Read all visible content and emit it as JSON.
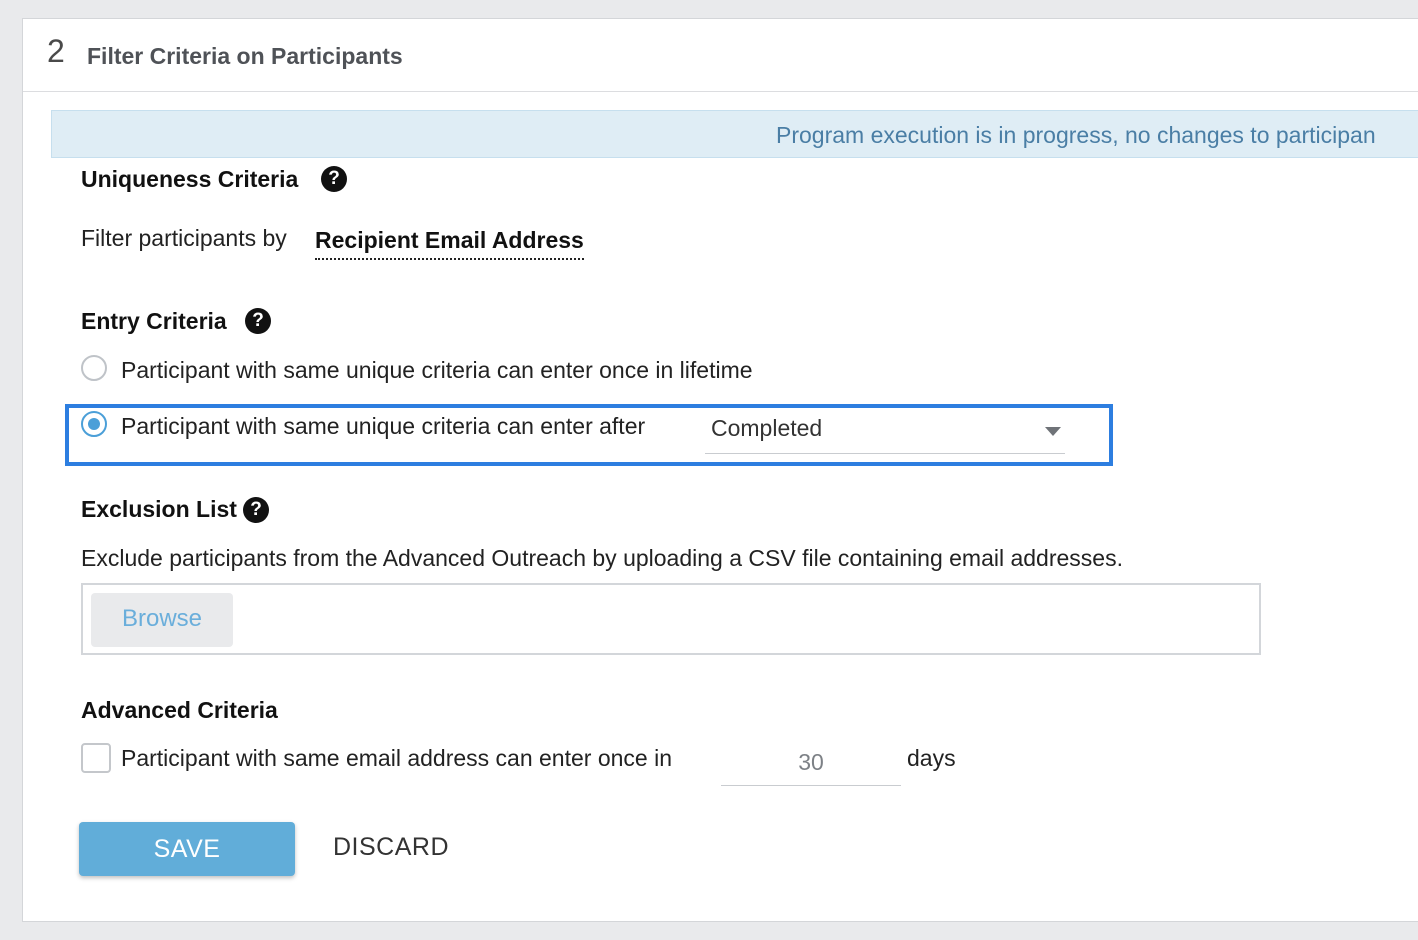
{
  "header": {
    "step_number": "2",
    "title": "Filter Criteria on Participants"
  },
  "banner": {
    "message": "Program execution is in progress, no changes to participan"
  },
  "uniqueness": {
    "title": "Uniqueness Criteria",
    "filter_label": "Filter participants by",
    "filter_value": "Recipient Email Address"
  },
  "entry": {
    "title": "Entry Criteria",
    "option_once": "Participant with same unique criteria can enter once in lifetime",
    "option_after": "Participant with same unique criteria can enter after",
    "selected_option": "option_after",
    "after_select_value": "Completed"
  },
  "exclusion": {
    "title": "Exclusion List",
    "description": "Exclude participants from the Advanced Outreach by uploading a CSV file containing email addresses.",
    "browse_label": "Browse"
  },
  "advanced": {
    "title": "Advanced Criteria",
    "checkbox_label": "Participant with same email address can enter once in",
    "checked": false,
    "days_value": "30",
    "days_unit": "days"
  },
  "actions": {
    "save_label": "SAVE",
    "discard_label": "DISCARD"
  },
  "icons": {
    "help": "question-circle-icon",
    "dropdown": "caret-down-icon"
  },
  "colors": {
    "accent": "#2d7ee0",
    "primary_button": "#61add9",
    "banner_bg": "#dfedf5",
    "banner_text": "#4a7ea5"
  }
}
